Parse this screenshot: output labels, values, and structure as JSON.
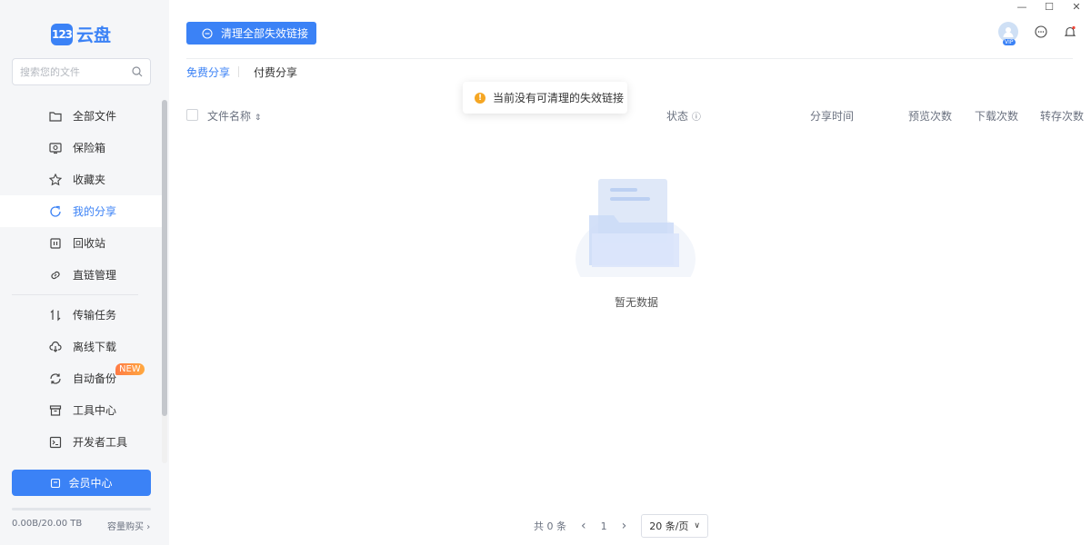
{
  "sidebar": {
    "logo_number": "123",
    "logo_text": "云盘",
    "search_placeholder": "搜索您的文件",
    "items": [
      {
        "label": "全部文件",
        "icon": "folder-icon"
      },
      {
        "label": "保险箱",
        "icon": "safe-icon"
      },
      {
        "label": "收藏夹",
        "icon": "star-icon"
      },
      {
        "label": "我的分享",
        "icon": "share-icon",
        "active": true
      },
      {
        "label": "回收站",
        "icon": "trash-icon"
      },
      {
        "label": "直链管理",
        "icon": "link-icon"
      },
      {
        "label": "传输任务",
        "icon": "transfer-icon"
      },
      {
        "label": "离线下载",
        "icon": "cloud-download-icon"
      },
      {
        "label": "自动备份",
        "icon": "sync-icon",
        "badge": "NEW"
      },
      {
        "label": "工具中心",
        "icon": "toolbox-icon"
      },
      {
        "label": "开发者工具",
        "icon": "terminal-icon"
      }
    ],
    "vip_button": "会员中心",
    "storage_used_fraction": 0.0,
    "storage_text": "0.00B/20.00 TB",
    "buy_text": "容量购买"
  },
  "toolbar": {
    "clear_button": "清理全部失效链接"
  },
  "avatar_badge": "VIP",
  "tabs": [
    {
      "label": "免费分享",
      "active": true
    },
    {
      "label": "付费分享",
      "active": false
    }
  ],
  "toast": {
    "message": "当前没有可清理的失效链接"
  },
  "table": {
    "columns": [
      "文件名称",
      "状态",
      "分享时间",
      "预览次数",
      "下载次数",
      "转存次数"
    ]
  },
  "empty_state": {
    "text": "暂无数据"
  },
  "pagination": {
    "total": "共 0 条",
    "current_page": "1",
    "page_size": "20 条/页"
  },
  "colors": {
    "accent": "#3b82f6",
    "sidebar_bg": "#f5f6f8",
    "warning": "#f5a623"
  }
}
